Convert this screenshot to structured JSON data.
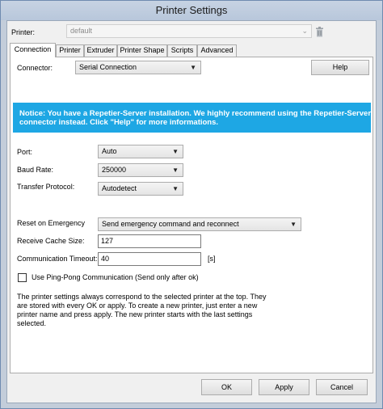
{
  "window": {
    "title": "Printer Settings"
  },
  "printer": {
    "label": "Printer:",
    "value": "default",
    "delete_icon": "trash-icon"
  },
  "tabs": [
    {
      "label": "Connection",
      "active": true
    },
    {
      "label": "Printer",
      "active": false
    },
    {
      "label": "Extruder",
      "active": false
    },
    {
      "label": "Printer Shape",
      "active": false
    },
    {
      "label": "Scripts",
      "active": false
    },
    {
      "label": "Advanced",
      "active": false
    }
  ],
  "connection": {
    "connector_label": "Connector:",
    "connector_value": "Serial Connection",
    "help_label": "Help",
    "notice": "Notice: You have a Repetier-Server installation. We highly recommend using the Repetier-Server connector instead. Click \"Help\" for more informations.",
    "notice_color": "#1ea7e4",
    "port_label": "Port:",
    "port_value": "Auto",
    "baud_label": "Baud Rate:",
    "baud_value": "250000",
    "protocol_label": "Transfer Protocol:",
    "protocol_value": "Autodetect",
    "emergency_label": "Reset on Emergency",
    "emergency_value": "Send emergency command and reconnect",
    "cache_label": "Receive Cache Size:",
    "cache_value": "127",
    "timeout_label": "Communication Timeout:",
    "timeout_value": "40",
    "timeout_unit": "[s]",
    "pingpong_label": "Use Ping-Pong Communication (Send only after ok)",
    "pingpong_checked": false,
    "info": "The printer settings always correspond to the selected printer at the top. They are stored with every OK or apply. To create a new printer, just enter a new printer name and press apply. The new printer starts with the last settings selected."
  },
  "buttons": {
    "ok": "OK",
    "apply": "Apply",
    "cancel": "Cancel"
  }
}
